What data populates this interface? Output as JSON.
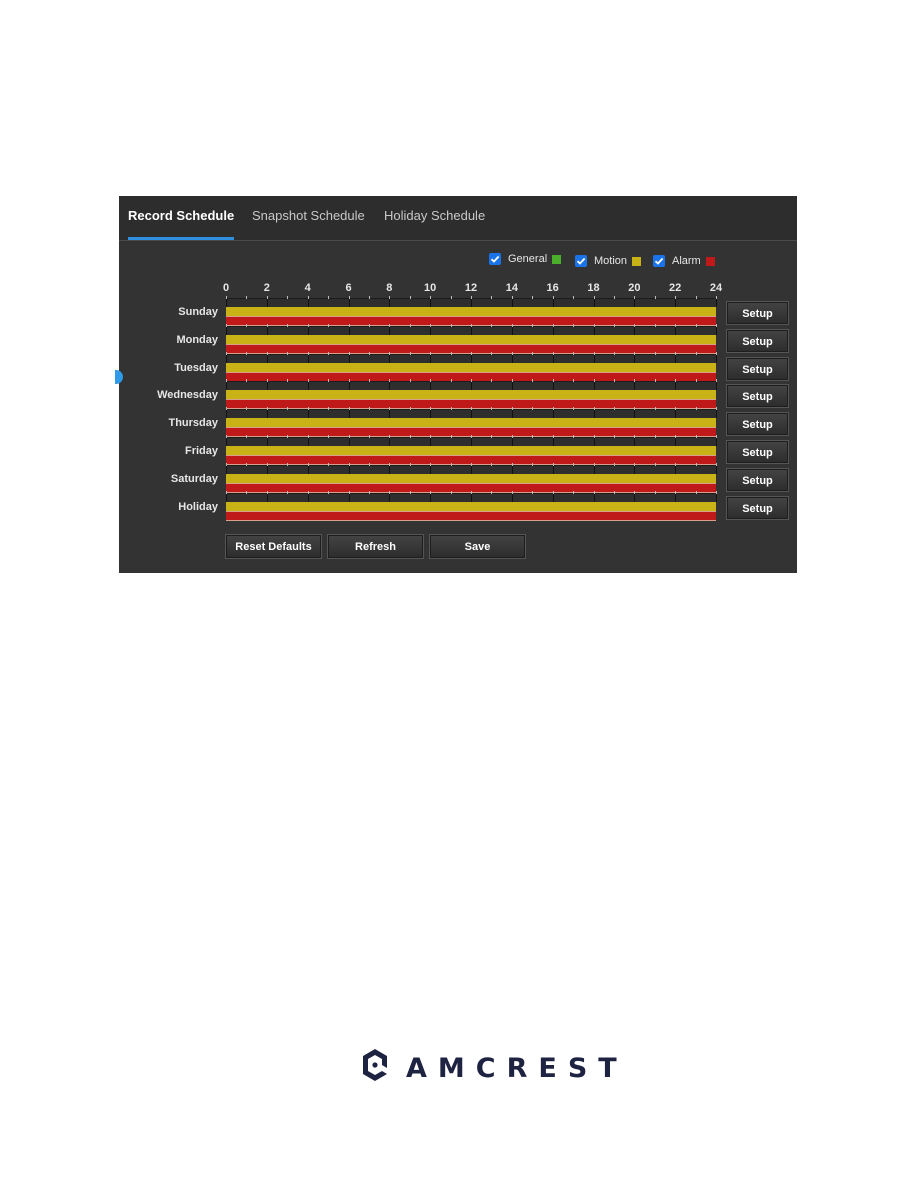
{
  "tabs": [
    {
      "label": "Record Schedule",
      "active": true
    },
    {
      "label": "Snapshot Schedule",
      "active": false
    },
    {
      "label": "Holiday Schedule",
      "active": false
    }
  ],
  "legend": [
    {
      "label": "General",
      "checked": true,
      "color": "#4caf2c"
    },
    {
      "label": "Motion",
      "checked": true,
      "color": "#c9b216"
    },
    {
      "label": "Alarm",
      "checked": true,
      "color": "#c01919"
    }
  ],
  "axis": {
    "hour_labels": [
      "0",
      "2",
      "4",
      "6",
      "8",
      "10",
      "12",
      "14",
      "16",
      "18",
      "20",
      "22",
      "24"
    ],
    "range_hours": [
      0,
      24
    ]
  },
  "schedule": [
    {
      "day": "Sunday",
      "motion": [
        0,
        24
      ],
      "alarm": [
        0,
        24
      ],
      "setup_label": "Setup"
    },
    {
      "day": "Monday",
      "motion": [
        0,
        24
      ],
      "alarm": [
        0,
        24
      ],
      "setup_label": "Setup"
    },
    {
      "day": "Tuesday",
      "motion": [
        0,
        24
      ],
      "alarm": [
        0,
        24
      ],
      "setup_label": "Setup"
    },
    {
      "day": "Wednesday",
      "motion": [
        0,
        24
      ],
      "alarm": [
        0,
        24
      ],
      "setup_label": "Setup"
    },
    {
      "day": "Thursday",
      "motion": [
        0,
        24
      ],
      "alarm": [
        0,
        24
      ],
      "setup_label": "Setup"
    },
    {
      "day": "Friday",
      "motion": [
        0,
        24
      ],
      "alarm": [
        0,
        24
      ],
      "setup_label": "Setup"
    },
    {
      "day": "Saturday",
      "motion": [
        0,
        24
      ],
      "alarm": [
        0,
        24
      ],
      "setup_label": "Setup"
    },
    {
      "day": "Holiday",
      "motion": [
        0,
        24
      ],
      "alarm": [
        0,
        24
      ],
      "setup_label": "Setup"
    }
  ],
  "footer": {
    "reset_label": "Reset Defaults",
    "refresh_label": "Refresh",
    "save_label": "Save"
  },
  "brand": {
    "name": "AMCREST",
    "color": "#1f2342",
    "accent": "#2f8fe0"
  }
}
